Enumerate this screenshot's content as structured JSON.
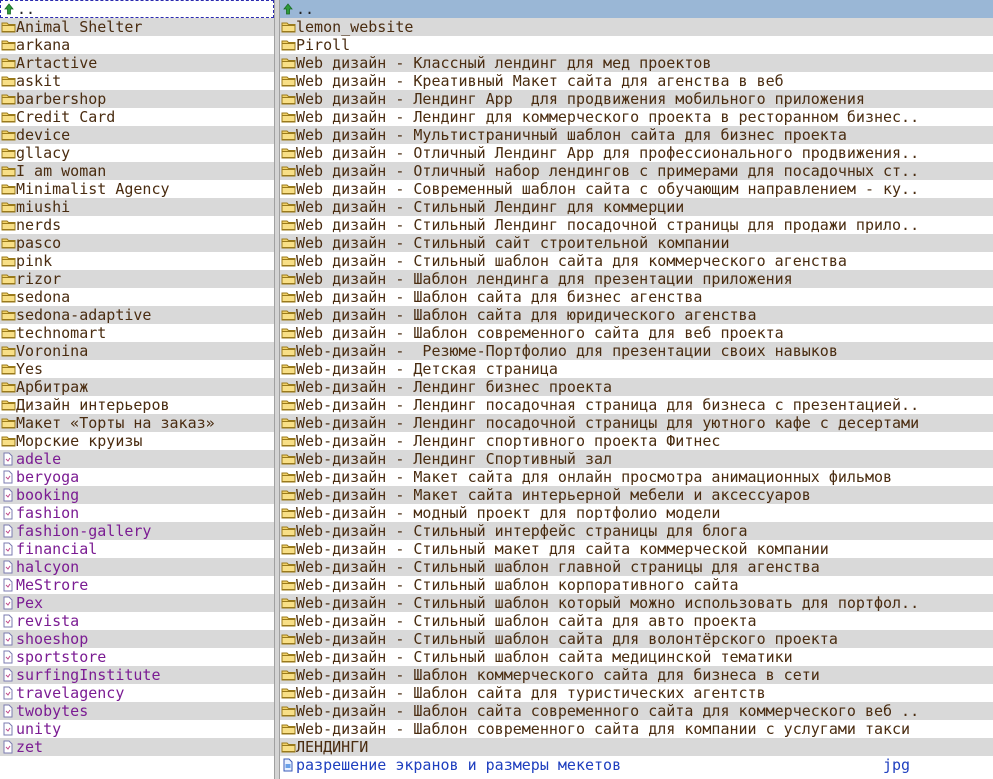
{
  "left_panel": {
    "up_label": "..",
    "folders": [
      "Animal Shelter",
      "arkana",
      "Artactive",
      "askit",
      "barbershop",
      "Credit Card",
      "device",
      "gllacy",
      "I am woman",
      "Minimalist Agency",
      "miushi",
      "nerds",
      "pasco",
      "pink",
      "rizor",
      "sedona",
      "sedona-adaptive",
      "technomart",
      "Voronina",
      "Yes",
      "Арбитраж",
      "Дизайн интерьеров",
      "Макет «Торты на заказ»",
      "Морские круизы"
    ],
    "files": [
      "adele",
      "beryoga",
      "booking",
      "fashion",
      "fashion-gallery",
      "financial",
      "halcyon",
      "MeStrore",
      "Pex",
      "revista",
      "shoeshop",
      "sportstore",
      "surfingInstitute",
      "travelagency",
      "twobytes",
      "unity",
      "zet"
    ]
  },
  "right_panel": {
    "up_label": "..",
    "folders": [
      "lemon_website",
      "Piroll",
      "Web дизайн - Классный лендинг для мед проектов",
      "Web дизайн - Креативный Макет сайта для агенства в веб",
      "Web дизайн - Лендинг App  для продвижения мобильного приложения",
      "Web дизайн - Лендинг для коммерческого проекта в ресторанном бизнес..",
      "Web дизайн - Мультистраничный шаблон сайта для бизнес проекта",
      "Web дизайн - Отличный Лендинг App для профессионального продвижения..",
      "Web дизайн - Отличный набор лендингов с примерами для посадочных ст..",
      "Web дизайн - Современный шаблон сайта с обучающим направлением - ку..",
      "Web дизайн - Стильный Лендинг для коммерции",
      "Web дизайн - Стильный Лендинг посадочной страницы для продажи прило..",
      "Web дизайн - Стильный сайт строительной компании",
      "Web дизайн - Стильный шаблон сайта для коммерческого агенства",
      "Web дизайн - Шаблон лендинга для презентации приложения",
      "Web дизайн - Шаблон сайта для бизнес агенства",
      "Web дизайн - Шаблон сайта для юридического агенства",
      "Web дизайн - Шаблон современного сайта для веб проекта",
      "Web-дизайн -  Резюме-Портфолио для презентации своих навыков",
      "Web-дизайн - Детская страница",
      "Web-дизайн - Лендинг бизнес проекта",
      "Web-дизайн - Лендинг посадочная страница для бизнеса с презентацией..",
      "Web-дизайн - Лендинг посадочной страницы для уютного кафе с десертами",
      "Web-дизайн - Лендинг спортивного проекта Фитнес",
      "Web-дизайн - Лендинг Спортивный зал",
      "Web-дизайн - Макет сайта для онлайн просмотра анимационных фильмов",
      "Web-дизайн - Макет сайта интерьерной мебели и аксессуаров",
      "Web-дизайн - модный проект для портфолио модели",
      "Web-дизайн - Стильный интерфейс страницы для блога",
      "Web-дизайн - Стильный макет для сайта коммерческой компании",
      "Web-дизайн - Стильный шаблон главной страницы для агенства",
      "Web-дизайн - Стильный шаблон корпоративного сайта",
      "Web-дизайн - Стильный шаблон который можно использовать для портфол..",
      "Web-дизайн - Стильный шаблон сайта для авто проекта",
      "Web-дизайн - Стильный шаблон сайта для волонтёрского проекта",
      "Web-дизайн - Стильный шаблон сайта медицинской тематики",
      "Web-дизайн - Шаблон коммерческого сайта для бизнеса в сети",
      "Web-дизайн - Шаблон сайта для туристических агентств",
      "Web-дизайн - Шаблон сайта современного сайта для коммерческого веб ..",
      "Web-дизайн - Шаблон современного сайта для компании с услугами такси",
      "ЛЕНДИНГИ"
    ],
    "files": [
      {
        "name": "разрешение экранов и размеры мекетов",
        "ext": "jpg"
      }
    ]
  },
  "icons": {
    "folder": "folder-icon",
    "file": "file-icon",
    "image_file": "image-file-icon",
    "up": "up-arrow-icon"
  },
  "colors": {
    "folder_text": "#4a2c10",
    "file_text": "#7b1c93",
    "jpg_text": "#1f3fbf",
    "row_alt": "#d9d9d9",
    "right_header": "#9ab7d6"
  }
}
